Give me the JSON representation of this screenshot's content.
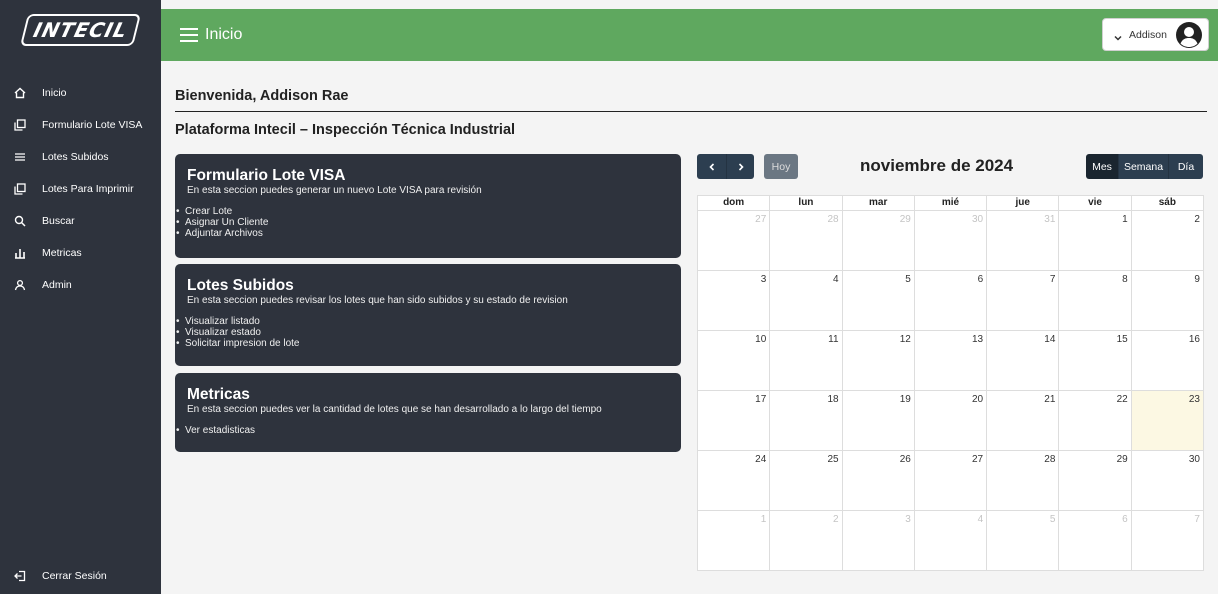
{
  "brand": {
    "logo_text": "INTECIL"
  },
  "sidebar": {
    "items": [
      {
        "label": "Inicio",
        "icon": "home-icon"
      },
      {
        "label": "Formulario Lote VISA",
        "icon": "copy-icon"
      },
      {
        "label": "Lotes Subidos",
        "icon": "list-icon"
      },
      {
        "label": "Lotes Para Imprimir",
        "icon": "copy-icon"
      },
      {
        "label": "Buscar",
        "icon": "search-icon"
      },
      {
        "label": "Metricas",
        "icon": "bar-chart-icon"
      },
      {
        "label": "Admin",
        "icon": "user-icon"
      }
    ],
    "logout_label": "Cerrar Sesión"
  },
  "header": {
    "title": "Inicio",
    "user_name": "Addison",
    "accent": "#5fa85f"
  },
  "main": {
    "welcome": "Bienvenida, Addison Rae",
    "subtitle": "Plataforma Intecil – Inspección Técnica Industrial",
    "cards": [
      {
        "title": "Formulario Lote VISA",
        "description": "En esta seccion puedes generar un nuevo Lote VISA para revisión",
        "items": [
          "Crear Lote",
          "Asignar Un Cliente",
          "Adjuntar Archivos"
        ]
      },
      {
        "title": "Lotes Subidos",
        "description": "En esta seccion puedes revisar los lotes que han sido subidos y su estado de revision",
        "items": [
          "Visualizar listado",
          "Visualizar estado",
          "Solicitar impresion de lote"
        ]
      },
      {
        "title": "Metricas",
        "description": "En esta seccion puedes ver la cantidad de lotes que se han desarrollado a lo largo del tiempo",
        "items": [
          "Ver estadisticas"
        ]
      }
    ]
  },
  "calendar": {
    "prev_label": "‹",
    "next_label": "›",
    "today_label": "Hoy",
    "title": "noviembre de 2024",
    "views": [
      "Mes",
      "Semana",
      "Día"
    ],
    "active_view": "Mes",
    "weekdays": [
      "dom",
      "lun",
      "mar",
      "mié",
      "jue",
      "vie",
      "sáb"
    ],
    "weeks": [
      [
        "27",
        "28",
        "29",
        "30",
        "31",
        "1",
        "2"
      ],
      [
        "3",
        "4",
        "5",
        "6",
        "7",
        "8",
        "9"
      ],
      [
        "10",
        "11",
        "12",
        "13",
        "14",
        "15",
        "16"
      ],
      [
        "17",
        "18",
        "19",
        "20",
        "21",
        "22",
        "23"
      ],
      [
        "24",
        "25",
        "26",
        "27",
        "28",
        "29",
        "30"
      ],
      [
        "1",
        "2",
        "3",
        "4",
        "5",
        "6",
        "7"
      ]
    ],
    "today_day": "23",
    "today_color": "#fcf8e3"
  }
}
